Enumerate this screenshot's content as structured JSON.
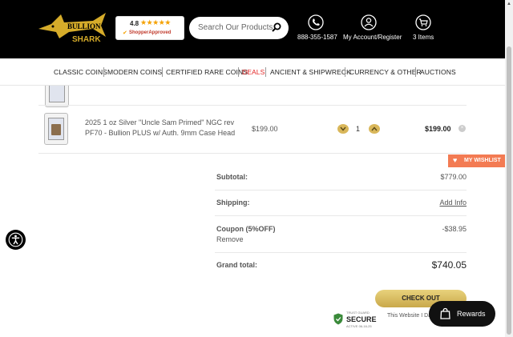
{
  "header": {
    "logo_text": "BULLION SHARK",
    "rating": {
      "score": "4.8",
      "stars": "★★★★★",
      "badge": "ShopperApproved"
    },
    "search": {
      "placeholder": "Search Our Products..."
    },
    "phone": "888-355-1587",
    "account": "My Account/Register",
    "cart": "3 Items"
  },
  "nav": {
    "items": [
      "CLASSIC COINS",
      "MODERN COINS",
      "CERTIFIED RARE COINS",
      "DEALS",
      "ANCIENT & SHIPWRECK",
      "CURRENCY & OTHER",
      "AUCTIONS"
    ],
    "highlight_color": "#e32626"
  },
  "cart": {
    "item": {
      "name": "2025 1 oz Silver \"Uncle Sam Primed\" NGC rev PF70 - Bullion PLUS w/ Auth. 9mm Case Head",
      "price": "$199.00",
      "qty": "1",
      "total": "$199.00",
      "remove": "×"
    }
  },
  "summary": {
    "subtotal_label": "Subtotal:",
    "subtotal_value": "$779.00",
    "shipping_label": "Shipping:",
    "shipping_value": "Add Info",
    "coupon_label": "Coupon (5%OFF)",
    "coupon_value": "-$38.95",
    "coupon_remove": "Remove",
    "grand_label": "Grand total:",
    "grand_value": "$740.05",
    "checkout": "CHECK OUT"
  },
  "wishlist": "MY WISHLIST",
  "trust": {
    "tag": "TRUST GUARD",
    "secure": "SECURE",
    "active": "ACTIVE",
    "date": "06-16-25",
    "text": "This Website I Daily for your P"
  },
  "rewards": "Rewards",
  "colors": {
    "gold": "#d9b75a",
    "wishlist": "#f37b53",
    "header_bg": "#000000"
  }
}
